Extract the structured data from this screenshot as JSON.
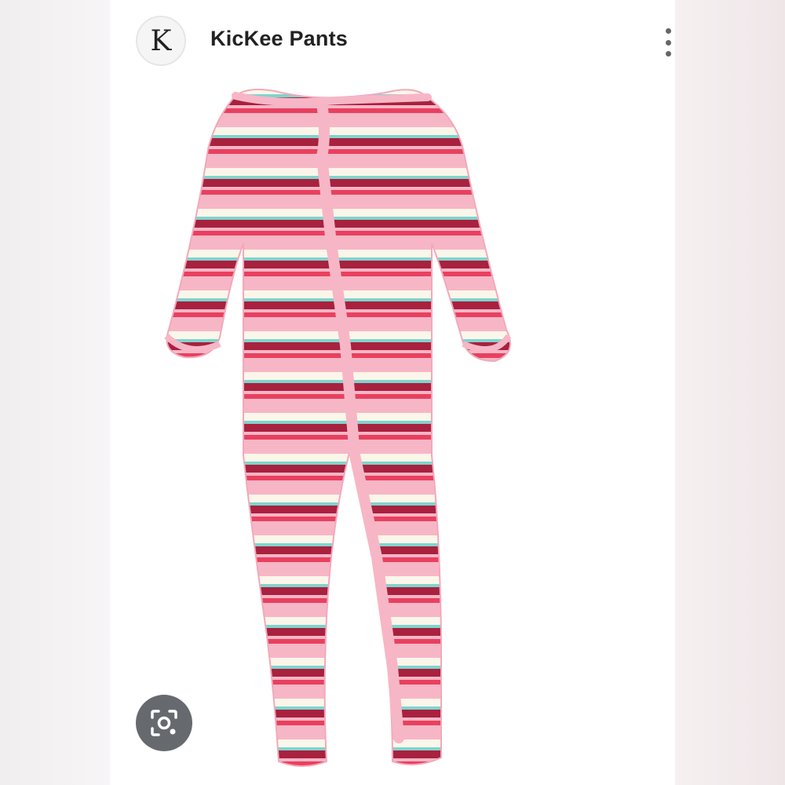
{
  "header": {
    "avatar_letter": "K",
    "brand_name": "KicKee Pants",
    "menu_icon": "more-vert-icon"
  },
  "image": {
    "subject": "striped-footed-sleeper",
    "stripe_colors": [
      "#f7b6c6",
      "#fbf6ea",
      "#a8213f",
      "#e9405f",
      "#7fd4cd"
    ]
  },
  "lens_button": {
    "icon": "google-lens-icon"
  }
}
